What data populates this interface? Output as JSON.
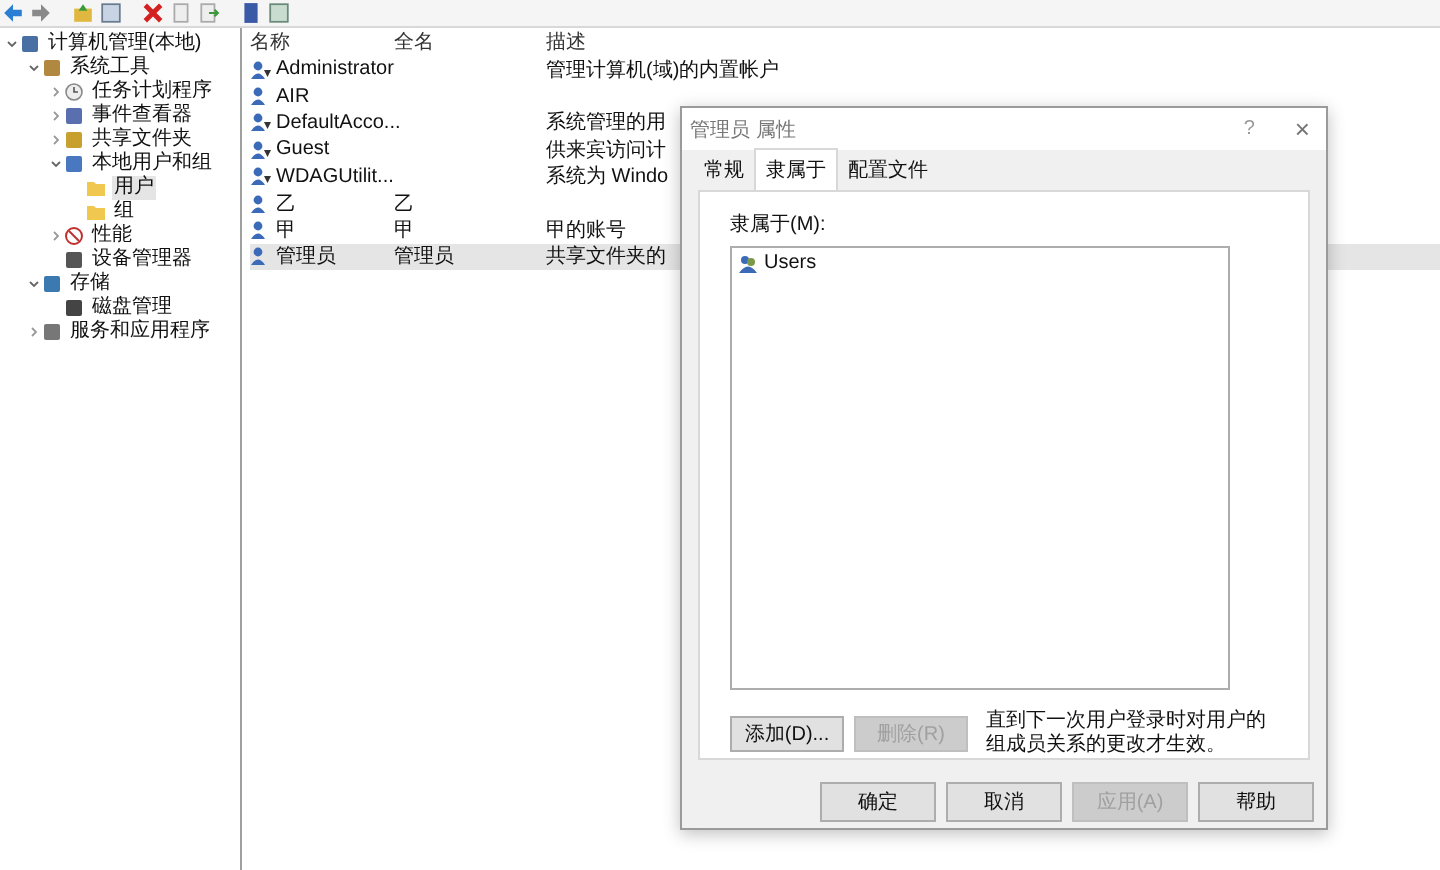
{
  "tree": [
    {
      "label": "计算机管理(本地)",
      "kind": "computer",
      "selected": false,
      "expanded": true,
      "children": [
        {
          "label": "系统工具",
          "kind": "tools",
          "selected": false,
          "expanded": true,
          "children": [
            {
              "label": "任务计划程序",
              "kind": "clock",
              "selected": false,
              "expanded": false
            },
            {
              "label": "事件查看器",
              "kind": "event",
              "selected": false,
              "expanded": false
            },
            {
              "label": "共享文件夹",
              "kind": "share",
              "selected": false,
              "expanded": false
            },
            {
              "label": "本地用户和组",
              "kind": "users",
              "selected": false,
              "expanded": true,
              "children": [
                {
                  "label": "用户",
                  "kind": "folder",
                  "selected": true
                },
                {
                  "label": "组",
                  "kind": "folder",
                  "selected": false
                }
              ]
            },
            {
              "label": "性能",
              "kind": "perf",
              "selected": false,
              "expanded": false
            },
            {
              "label": "设备管理器",
              "kind": "device",
              "selected": false
            }
          ]
        },
        {
          "label": "存储",
          "kind": "storage",
          "selected": false,
          "expanded": true,
          "children": [
            {
              "label": "磁盘管理",
              "kind": "disk",
              "selected": false
            }
          ]
        },
        {
          "label": "服务和应用程序",
          "kind": "services",
          "selected": false,
          "expanded": false
        }
      ]
    }
  ],
  "table": {
    "columns": [
      "名称",
      "全名",
      "描述"
    ],
    "rows": [
      {
        "name": "Administrator",
        "full_name": "",
        "description": "管理计算机(域)的内置帐户",
        "disabled": true,
        "selected": false
      },
      {
        "name": "AIR",
        "full_name": "",
        "description": "",
        "disabled": false,
        "selected": false
      },
      {
        "name": "DefaultAcco...",
        "full_name": "",
        "description": "系统管理的用",
        "disabled": true,
        "selected": false
      },
      {
        "name": "Guest",
        "full_name": "",
        "description": "供来宾访问计",
        "disabled": true,
        "selected": false
      },
      {
        "name": "WDAGUtilit...",
        "full_name": "",
        "description": "系统为 Windo",
        "disabled": true,
        "selected": false
      },
      {
        "name": "乙",
        "full_name": "乙",
        "description": "",
        "disabled": false,
        "selected": false
      },
      {
        "name": "甲",
        "full_name": "甲",
        "description": "甲的账号",
        "disabled": false,
        "selected": false
      },
      {
        "name": "管理员",
        "full_name": "管理员",
        "description": "共享文件夹的",
        "disabled": false,
        "selected": true
      }
    ]
  },
  "dialog": {
    "title": "管理员 属性",
    "help": "?",
    "close": "×",
    "tabs": [
      {
        "label": "常规",
        "selected": false
      },
      {
        "label": "隶属于",
        "selected": true
      },
      {
        "label": "配置文件",
        "selected": false
      }
    ],
    "list_label": "隶属于(M):",
    "groups": [
      {
        "name": "Users",
        "selected": false
      }
    ],
    "buttons": [
      {
        "label": "添加(D)...",
        "disabled": false
      },
      {
        "label": "删除(R)",
        "disabled": true
      }
    ],
    "note": "直到下一次用户登录时对用户的组成员关系的更改才生效。",
    "footer_buttons": [
      {
        "label": "确定",
        "disabled": false
      },
      {
        "label": "取消",
        "disabled": false
      },
      {
        "label": "应用(A)",
        "disabled": true
      },
      {
        "label": "帮助",
        "disabled": false
      }
    ]
  }
}
